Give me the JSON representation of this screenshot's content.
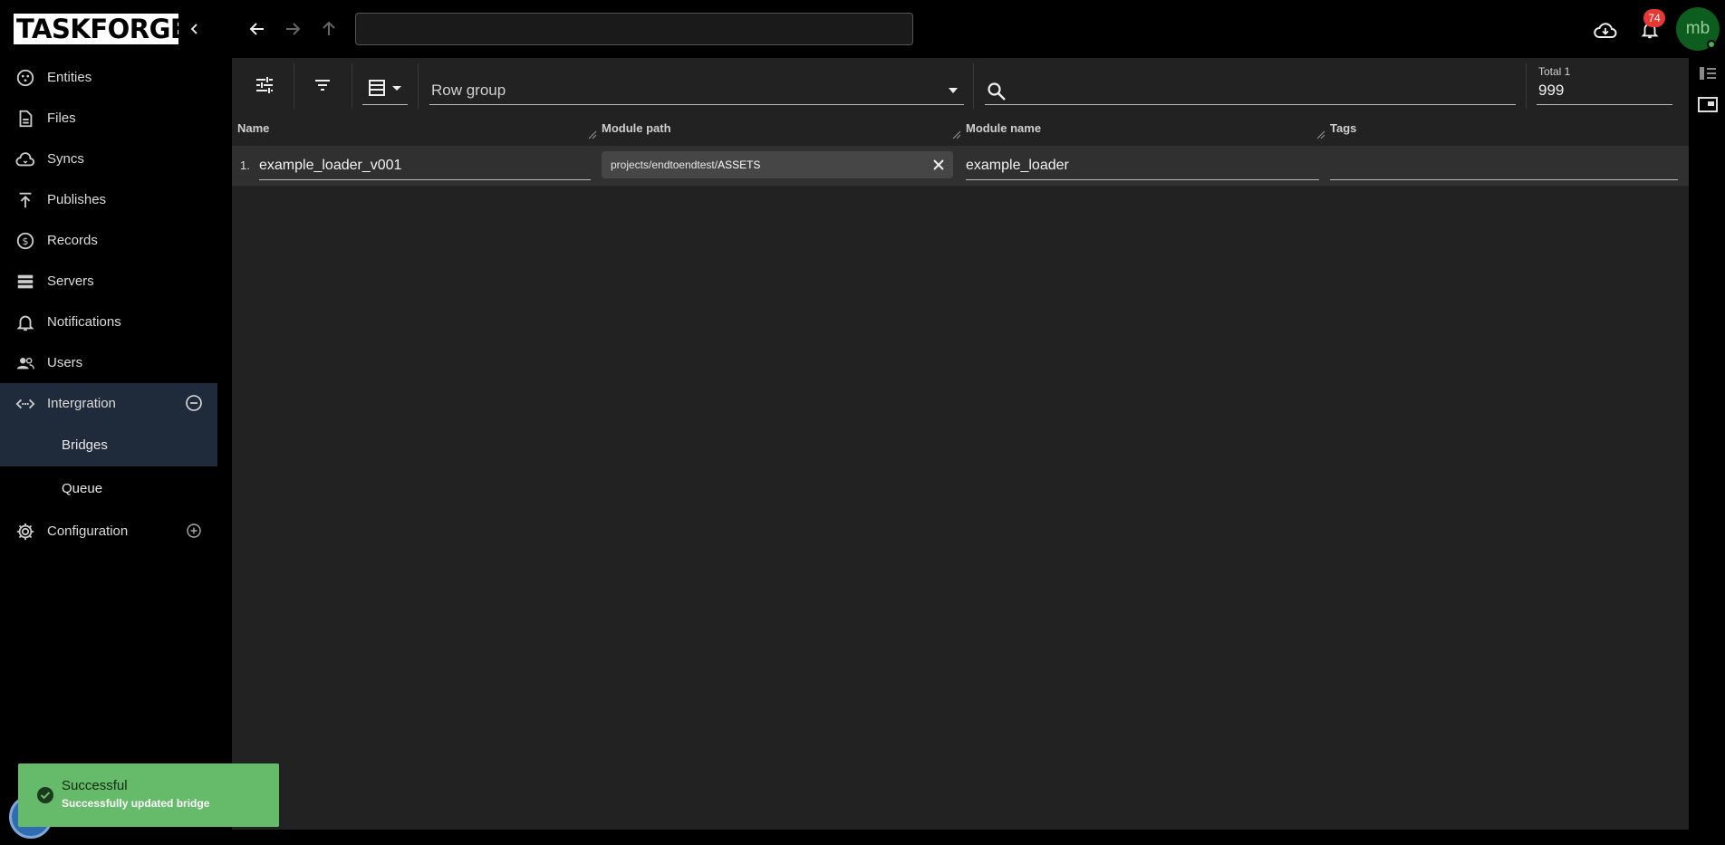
{
  "app": {
    "logo_text": "TASKFORGER"
  },
  "sidebar": {
    "items": [
      {
        "label": "Entities",
        "icon": "entities-icon"
      },
      {
        "label": "Files",
        "icon": "file-icon"
      },
      {
        "label": "Syncs",
        "icon": "cloud-sync-icon"
      },
      {
        "label": "Publishes",
        "icon": "publish-icon"
      },
      {
        "label": "Records",
        "icon": "dollar-icon"
      },
      {
        "label": "Servers",
        "icon": "server-icon"
      },
      {
        "label": "Notifications",
        "icon": "bell-icon"
      },
      {
        "label": "Users",
        "icon": "users-icon"
      }
    ],
    "integration": {
      "label": "Intergration",
      "sub": [
        "Bridges",
        "Queue"
      ]
    },
    "configuration": {
      "label": "Configuration"
    }
  },
  "topbar": {
    "path_value": "",
    "notification_count": "74",
    "avatar_initials": "mb"
  },
  "toolbar": {
    "row_group_label": "Row group",
    "search_value": "",
    "total_label": "Total 1",
    "total_value": "999"
  },
  "table": {
    "columns": [
      "Name",
      "Module path",
      "Module name",
      "Tags"
    ],
    "rows": [
      {
        "index": "1.",
        "name": "example_loader_v001",
        "module_path_prefix": "projects/endtoendtest/",
        "module_path_suffix": "ASSETS",
        "module_name": "example_loader",
        "tags": ""
      }
    ]
  },
  "toast": {
    "title": "Successful",
    "message": "Successfully updated bridge",
    "color": "#66bb6a"
  }
}
